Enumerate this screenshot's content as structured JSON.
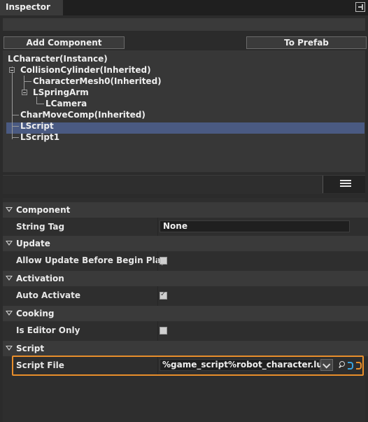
{
  "window": {
    "tab_title": "Inspector"
  },
  "toolbar": {
    "add_component": "Add Component",
    "to_prefab": "To Prefab"
  },
  "tree": {
    "items": [
      {
        "label": "LCharacter(Instance)"
      },
      {
        "label": "CollisionCylinder(Inherited)"
      },
      {
        "label": "CharacterMesh0(Inherited)"
      },
      {
        "label": "LSpringArm"
      },
      {
        "label": "LCamera"
      },
      {
        "label": "CharMoveComp(Inherited)"
      },
      {
        "label": "LScript"
      },
      {
        "label": "LScript1"
      }
    ],
    "selected": "LScript"
  },
  "details": {
    "categories": [
      {
        "label": "Component"
      },
      {
        "label": "Update"
      },
      {
        "label": "Activation"
      },
      {
        "label": "Cooking"
      },
      {
        "label": "Script"
      }
    ],
    "props": {
      "string_tag": {
        "label": "String Tag",
        "value": "None"
      },
      "allow_update": {
        "label": "Allow Update Before Begin Play",
        "checked": false
      },
      "auto_activate": {
        "label": "Auto Activate",
        "checked": true
      },
      "editor_only": {
        "label": "Is Editor Only",
        "checked": false
      },
      "script_file": {
        "label": "Script File",
        "value": "%game_script%robot_character.lua"
      }
    }
  },
  "colors": {
    "selection": "#4a5a82",
    "highlight": "#e88e2b",
    "accent_blue": "#3aa3e0"
  }
}
